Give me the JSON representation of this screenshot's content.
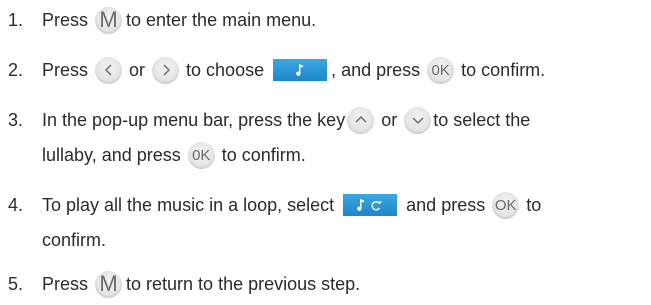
{
  "colors": {
    "text": "#2b2b2b",
    "key_bg": "#e4e4e4",
    "key_glyph": "#6a6a6a",
    "music_bg": "#2a95d4"
  },
  "icons": {
    "menu_key": "M-key-icon",
    "left_key": "left-arrow-key-icon",
    "right_key": "right-arrow-key-icon",
    "up_key": "up-arrow-key-icon",
    "down_key": "down-arrow-key-icon",
    "ok_key": "ok-key-icon",
    "music": "music-note-icon",
    "loop": "loop-music-icon"
  },
  "keys": {
    "m": "M",
    "ok": "0K",
    "ok_loop": "OK"
  },
  "steps": [
    {
      "num": "1.",
      "a": "Press",
      "b": "to enter the main menu."
    },
    {
      "num": "2.",
      "a": "Press",
      "b": "or",
      "c": "to choose",
      "d": ", and press",
      "e": "to confirm."
    },
    {
      "num": "3.",
      "a": "In the pop-up menu bar, press the key",
      "b": "or",
      "c": "to select the",
      "d": "lullaby, and press",
      "e": "to confirm."
    },
    {
      "num": "4.",
      "a": "To play all the music in a loop, select",
      "b": "and press",
      "c": "to",
      "d": "confirm."
    },
    {
      "num": "5.",
      "a": "Press",
      "b": "to return to the previous step."
    }
  ]
}
